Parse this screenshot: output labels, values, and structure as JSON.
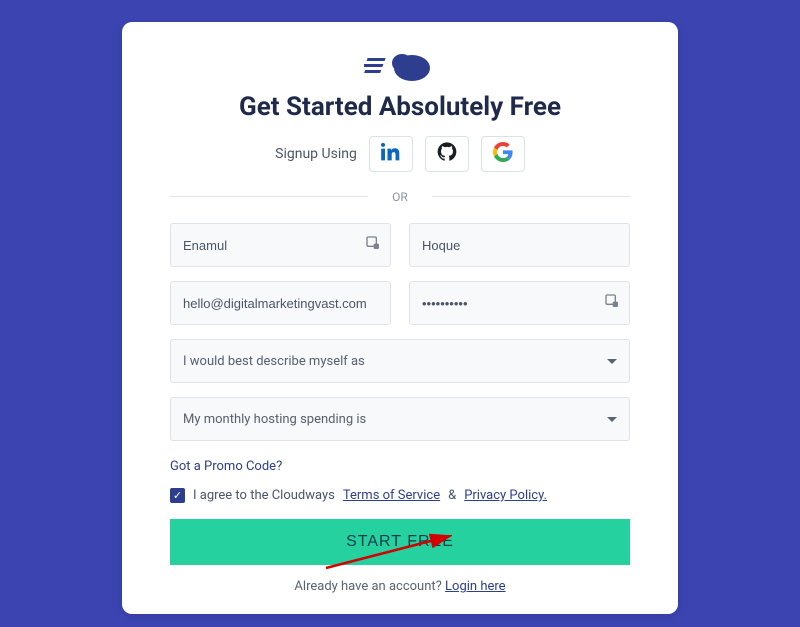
{
  "logo_alt": "cloud-speed-logo",
  "title": "Get Started Absolutely Free",
  "social": {
    "label": "Signup Using",
    "linkedin": "linkedin-icon",
    "github": "github-icon",
    "google": "google-icon"
  },
  "divider_text": "OR",
  "form": {
    "first_name": "Enamul",
    "last_name": "Hoque",
    "email": "hello@digitalmarketingvast.com",
    "password": "••••••••••",
    "select_describe": "I would best describe myself as",
    "select_spending": "My monthly hosting spending is"
  },
  "promo_text": "Got a Promo Code?",
  "agree": {
    "prefix": "I agree to the Cloudways",
    "tos": "Terms of Service",
    "amp": "&",
    "privacy": "Privacy Policy."
  },
  "start_button": "START FREE",
  "login": {
    "prefix": "Already have an account?",
    "link": "Login here"
  }
}
